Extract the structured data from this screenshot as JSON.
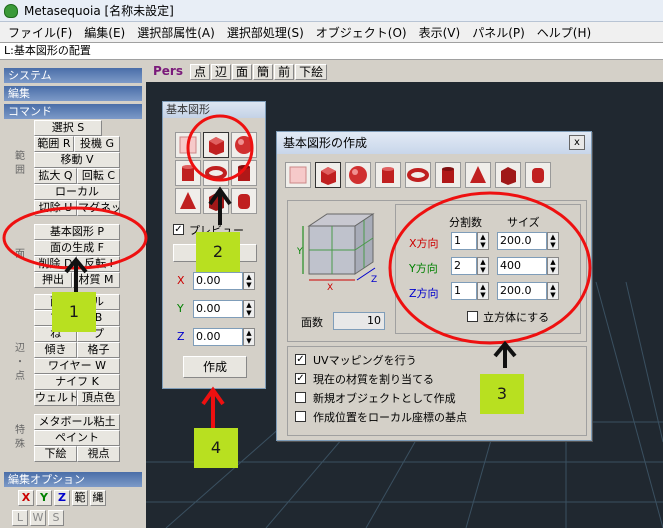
{
  "window": {
    "title": "Metasequoia [名称未設定]"
  },
  "menu": [
    "ファイル(F)",
    "編集(E)",
    "選択部属性(A)",
    "選択部処理(S)",
    "オブジェクト(O)",
    "表示(V)",
    "パネル(P)",
    "ヘルプ(H)"
  ],
  "status": "L:基本図形の配置",
  "left": {
    "sections": {
      "system": "システム",
      "edit": "編集",
      "command": "コマンド",
      "edit_option": "編集オプション"
    },
    "vlabels": {
      "select": "範囲",
      "face": "面",
      "edge": "辺・点",
      "special": "特殊"
    },
    "buttons": {
      "select": "選択 S",
      "range": "範囲 R",
      "lasso": "投機 G",
      "move": "移動 V",
      "scale": "拡大 Q",
      "rotate": "回転 C",
      "local": "ローカル",
      "mirror": "切除 U",
      "magnet": "マグネット",
      "basic_shape": "基本図形 P",
      "face_gen": "面の生成 F",
      "delete": "削除 D",
      "flip": "反転 I",
      "extrude": "押出",
      "material": "材質 M",
      "face_row1a": "面",
      "face_row1b": "ル",
      "edge_row1a": "マ",
      "edge_row1b": "B",
      "edge_row2a": "ね",
      "edge_row2b": "プ",
      "tilt": "傾き",
      "lattice": "格子",
      "wire": "ワイヤー W",
      "knife": "ナイフ K",
      "weld": "ウェルト",
      "vertex_color": "頂点色",
      "metaball": "メタボール粘土",
      "paint": "ペイント",
      "underlay": "下絵",
      "viewpoint": "視点"
    },
    "axis_buttons": [
      "X",
      "Y",
      "Z",
      "範",
      "縄"
    ],
    "lws_buttons": [
      "L",
      "W",
      "S"
    ]
  },
  "viewport": {
    "toolbar": [
      "Pers",
      "点",
      "辺",
      "面",
      "簡",
      "前",
      "下絵"
    ]
  },
  "basic_panel": {
    "title": "基本図形",
    "preview_label": "プレビュー",
    "coords": [
      {
        "axis": "X",
        "value": "0.00"
      },
      {
        "axis": "Y",
        "value": "0.00"
      },
      {
        "axis": "Z",
        "value": "0.00"
      }
    ],
    "create_label": "作成"
  },
  "dialog": {
    "title": "基本図形の作成",
    "close": "x",
    "col_div": "分割数",
    "col_size": "サイズ",
    "rows": [
      {
        "label": "X方向",
        "div": "1",
        "size": "200.0",
        "color": "#cc0000"
      },
      {
        "label": "Y方向",
        "div": "2",
        "size": "400",
        "color": "#008000"
      },
      {
        "label": "Z方向",
        "div": "1",
        "size": "200.0",
        "color": "#0000cc"
      }
    ],
    "face_count_label": "面数",
    "face_count": "10",
    "cube_label": "立方体にする",
    "options": [
      {
        "label": "UVマッピングを行う",
        "checked": true
      },
      {
        "label": "現在の材質を割り当てる",
        "checked": true
      },
      {
        "label": "新規オブジェクトとして作成",
        "checked": false
      },
      {
        "label": "作成位置をローカル座標の基点",
        "checked": false
      }
    ],
    "axis_labels": {
      "x": "X",
      "y": "Y",
      "z": "Z"
    }
  },
  "annotations": [
    "1",
    "2",
    "3",
    "4"
  ]
}
